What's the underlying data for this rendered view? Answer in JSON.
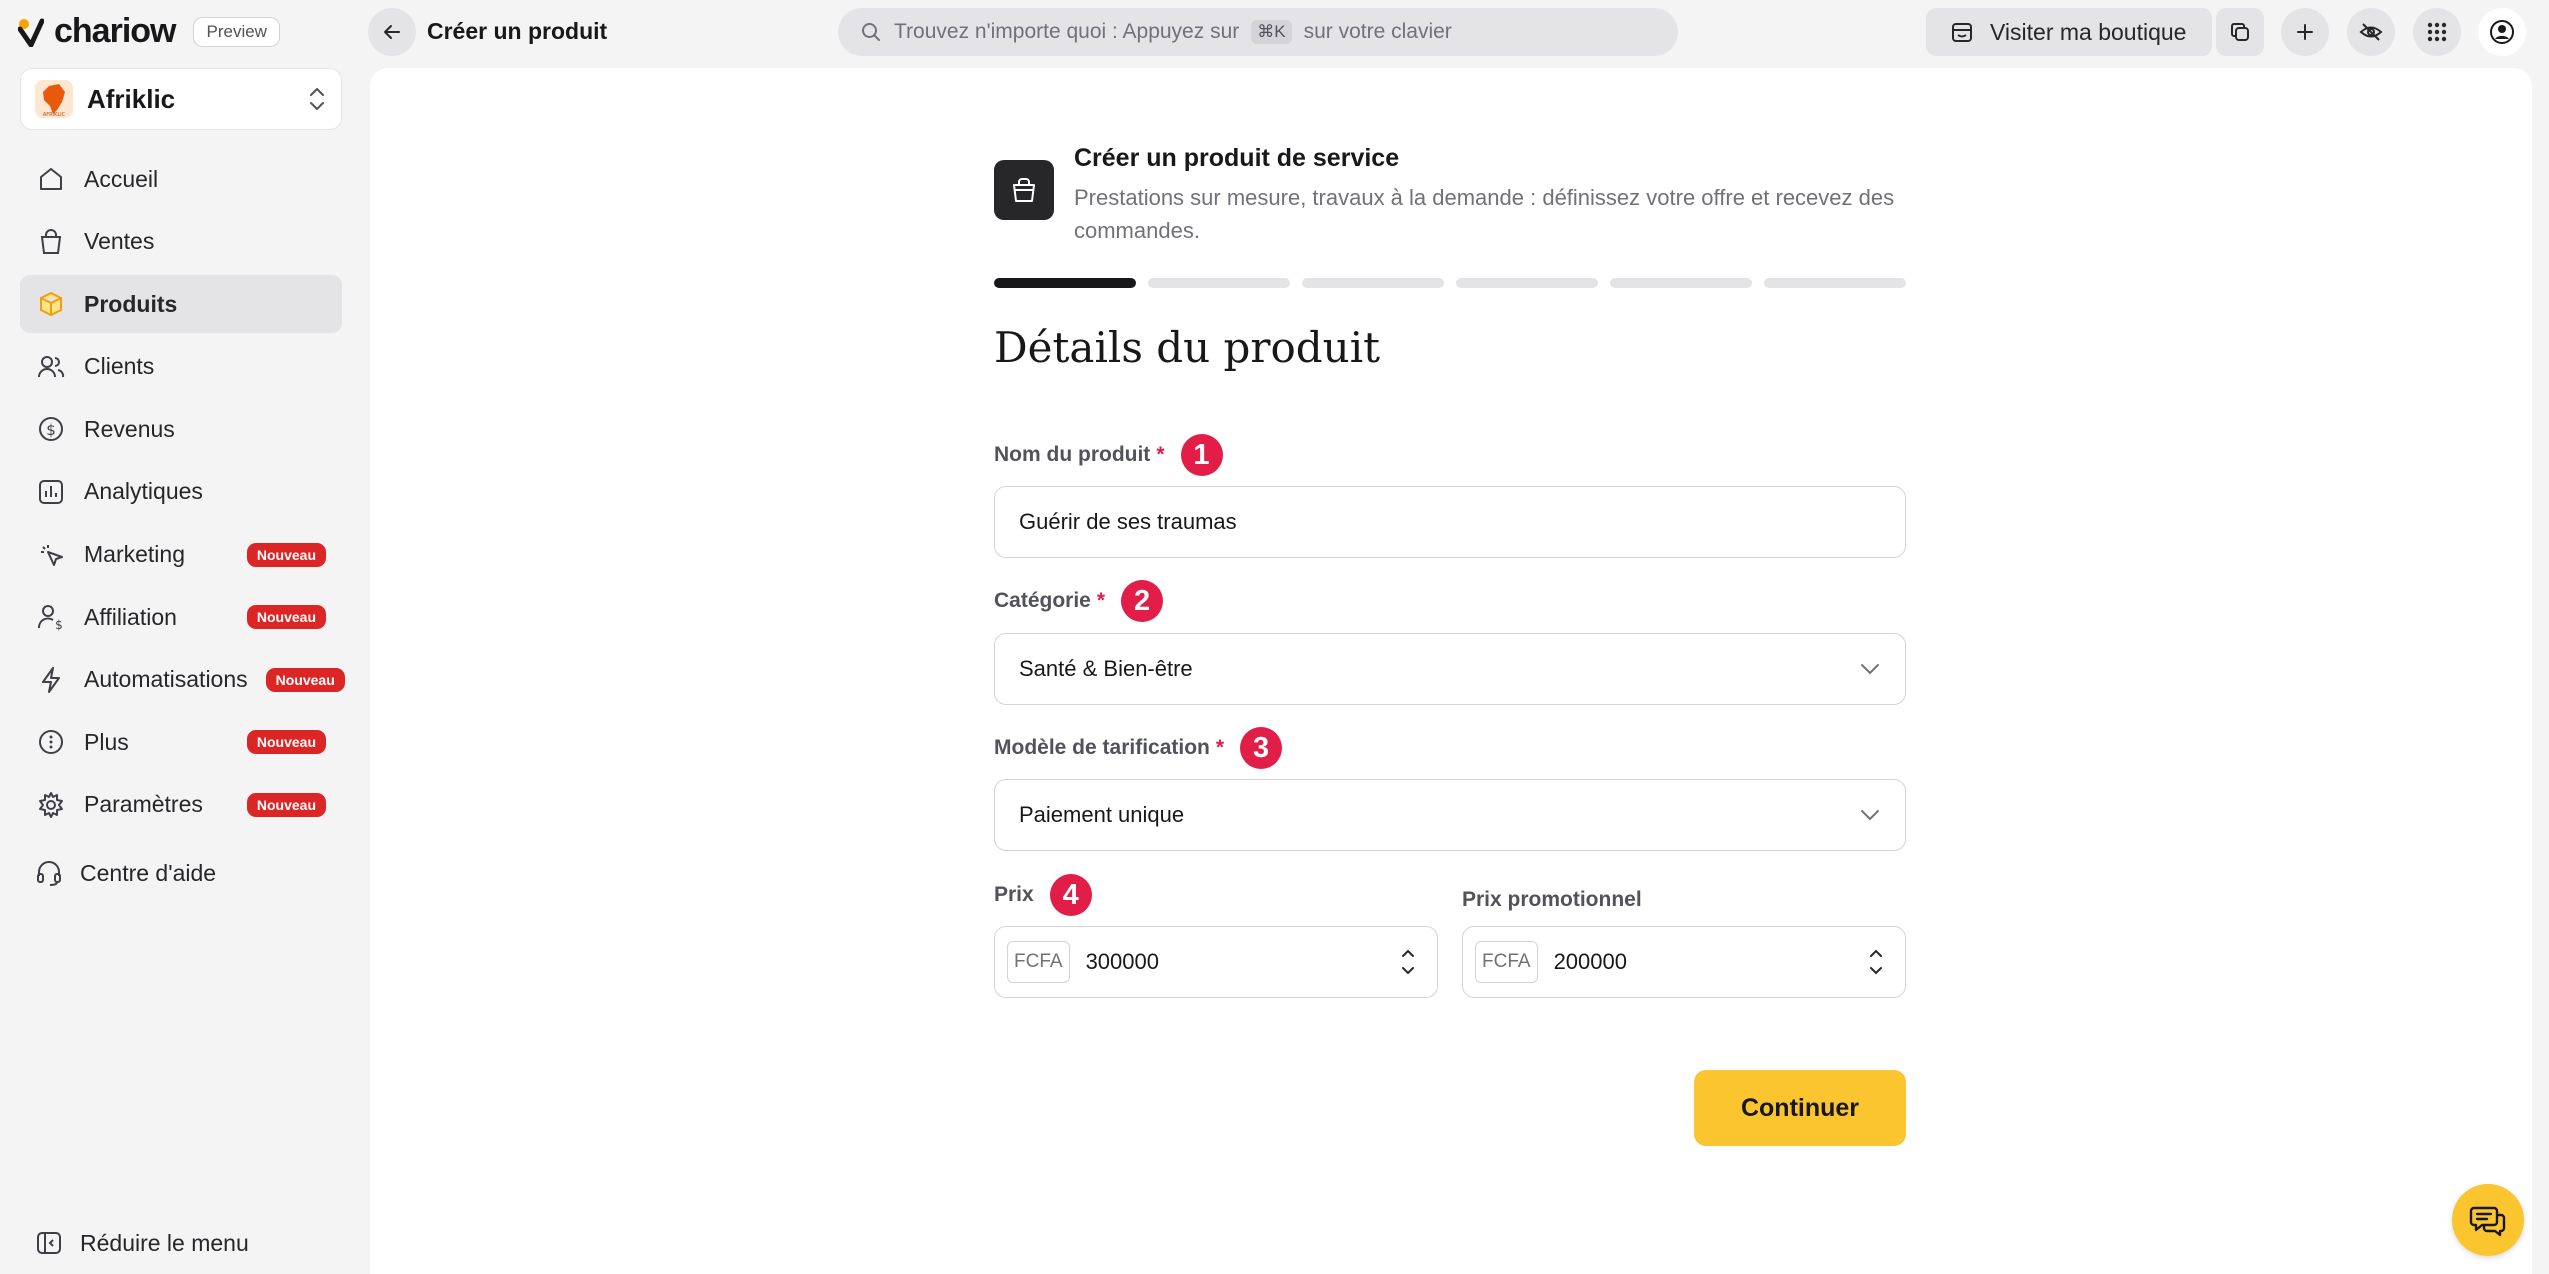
{
  "brand": {
    "name": "chariow",
    "badge": "Preview"
  },
  "store": {
    "name": "Afriklic",
    "avatar_text": "AFRIKLIC"
  },
  "nav": {
    "items": [
      {
        "label": "Accueil",
        "icon": "home-icon",
        "badge": ""
      },
      {
        "label": "Ventes",
        "icon": "shopping-bag-icon",
        "badge": ""
      },
      {
        "label": "Produits",
        "icon": "box-icon",
        "badge": "",
        "active": true
      },
      {
        "label": "Clients",
        "icon": "users-icon",
        "badge": ""
      },
      {
        "label": "Revenus",
        "icon": "dollar-circle-icon",
        "badge": ""
      },
      {
        "label": "Analytiques",
        "icon": "chart-icon",
        "badge": ""
      },
      {
        "label": "Marketing",
        "icon": "cursor-click-icon",
        "badge": "Nouveau"
      },
      {
        "label": "Affiliation",
        "icon": "user-dollar-icon",
        "badge": "Nouveau"
      },
      {
        "label": "Automatisations",
        "icon": "bolt-icon",
        "badge": "Nouveau"
      },
      {
        "label": "Plus",
        "icon": "more-circle-icon",
        "badge": "Nouveau"
      },
      {
        "label": "Paramètres",
        "icon": "gear-icon",
        "badge": "Nouveau"
      }
    ],
    "help": "Centre d'aide",
    "collapse": "Réduire le menu"
  },
  "topbar": {
    "title": "Créer un produit",
    "search_text": "Trouvez n'importe quoi : Appuyez sur",
    "search_kbd": "⌘K",
    "search_suffix": "sur votre clavier",
    "visit_label": "Visiter ma boutique"
  },
  "form": {
    "header_title": "Créer un produit de service",
    "header_desc": "Prestations sur mesure, travaux à la demande : définissez votre offre et recevez des commandes.",
    "steps_total": 6,
    "steps_done": 1,
    "section_title": "Détails du produit",
    "name_label": "Nom du produit",
    "name_value": "Guérir de ses traumas",
    "category_label": "Catégorie",
    "category_value": "Santé & Bien-être",
    "pricing_label": "Modèle de tarification",
    "pricing_value": "Paiement unique",
    "price_label": "Prix",
    "price_currency": "FCFA",
    "price_value": "300000",
    "promo_label": "Prix promotionnel",
    "promo_currency": "FCFA",
    "promo_value": "200000",
    "continue_label": "Continuer",
    "required_mark": "*",
    "markers": [
      "1",
      "2",
      "3",
      "4"
    ]
  },
  "colors": {
    "accent": "#fbc530",
    "danger": "#e11d48",
    "badge": "#dc2626"
  }
}
